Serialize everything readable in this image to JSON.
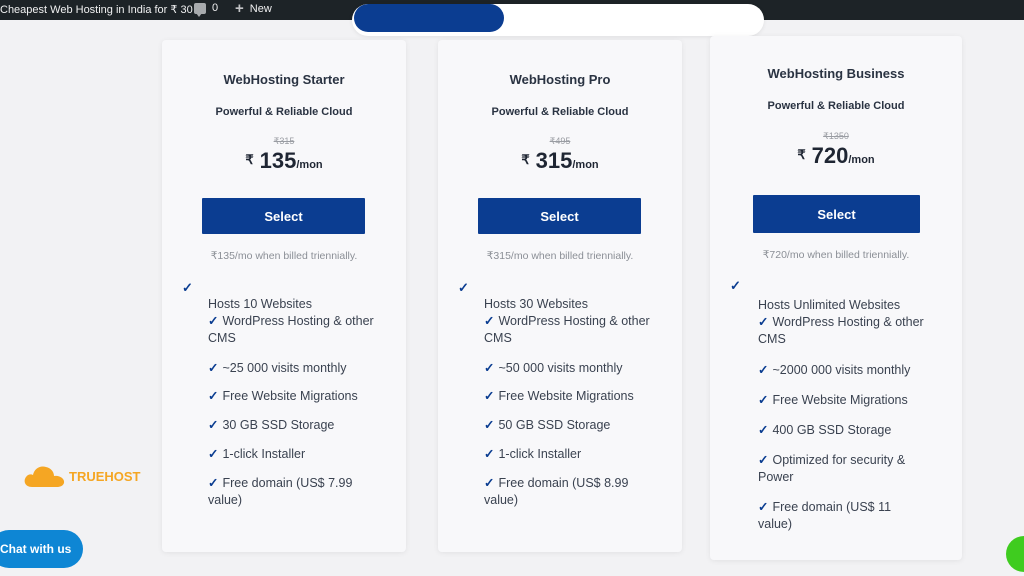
{
  "adminbar": {
    "site_title": "Cheapest Web Hosting in India for ₹ 30",
    "comments_count": "0",
    "new_label": "New"
  },
  "plans": [
    {
      "name": "WebHosting Starter",
      "subtitle": "Powerful & Reliable Cloud",
      "old_price": "₹315",
      "currency": "₹",
      "price": "135",
      "period": "/mon",
      "select_label": "Select",
      "billing_note": "₹135/mo when billed triennially.",
      "features": [
        "Hosts 10 Websites",
        "WordPress Hosting & other CMS",
        "~25 000 visits monthly",
        "Free Website Migrations",
        "30 GB SSD Storage",
        "1-click Installer",
        "Free domain (US$ 7.99 value)"
      ]
    },
    {
      "name": "WebHosting Pro",
      "subtitle": "Powerful & Reliable Cloud",
      "old_price": "₹495",
      "currency": "₹",
      "price": "315",
      "period": "/mon",
      "select_label": "Select",
      "billing_note": "₹315/mo when billed triennially.",
      "features": [
        "Hosts 30 Websites",
        "WordPress Hosting & other CMS",
        "~50 000 visits monthly",
        "Free Website Migrations",
        "50 GB SSD Storage",
        "1-click Installer",
        "Free domain (US$ 8.99 value)"
      ]
    },
    {
      "name": "WebHosting Business",
      "subtitle": "Powerful & Reliable Cloud",
      "old_price": "₹1350",
      "currency": "₹",
      "price": "720",
      "period": "/mon",
      "select_label": "Select",
      "billing_note": "₹720/mo when billed triennially.",
      "features": [
        "Hosts Unlimited Websites",
        "WordPress Hosting & other CMS",
        "~2000 000 visits monthly",
        "Free Website Migrations",
        "400 GB SSD Storage",
        "Optimized for security & Power",
        "Free domain (US$ 11 value)"
      ]
    }
  ],
  "logo_text": "TRUEHOST",
  "chat_label": "Chat with us",
  "colors": {
    "brand_blue": "#0b3d91",
    "chat_blue": "#0e86d4",
    "logo_orange": "#f5a623",
    "green": "#3fcc1f"
  }
}
